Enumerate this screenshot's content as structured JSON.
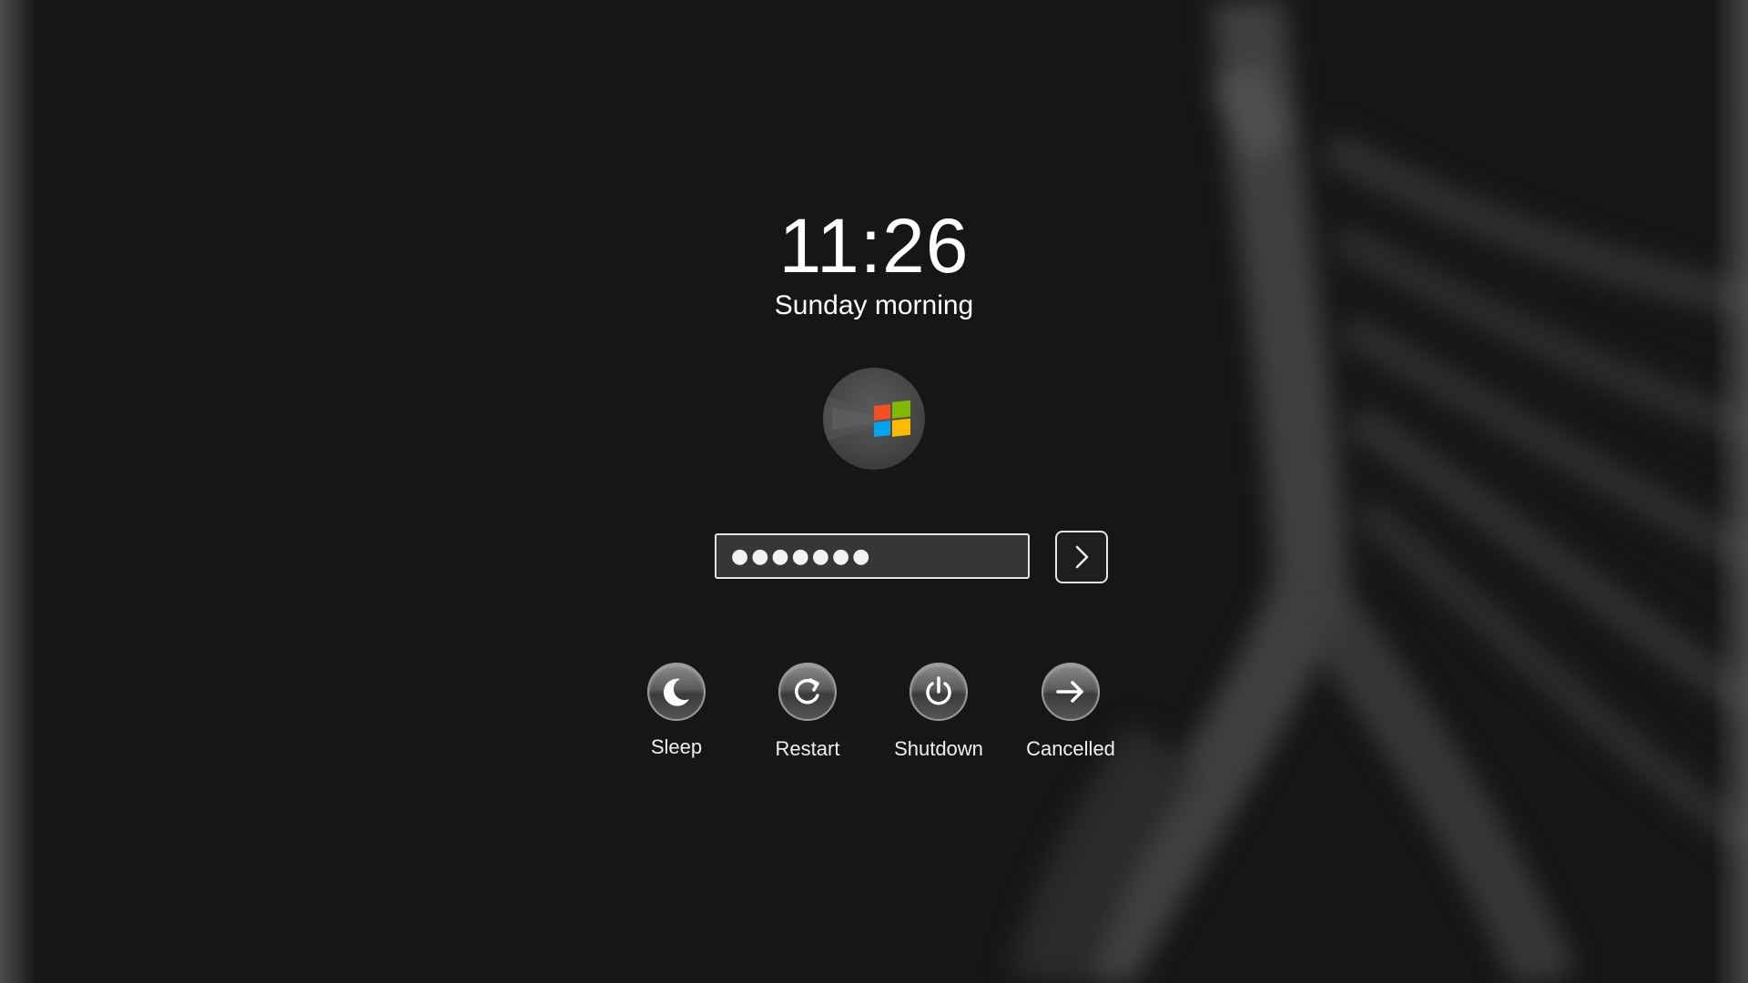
{
  "lock_screen": {
    "time": "11:26",
    "greeting": "Sunday morning"
  },
  "user": {
    "avatar_icon": "windows-logo-icon"
  },
  "login": {
    "password_masked": "●●●●●●●",
    "submit_icon": "chevron-right-icon"
  },
  "power_actions": [
    {
      "label": "Sleep",
      "icon": "moon-icon"
    },
    {
      "label": "Restart",
      "icon": "restart-icon"
    },
    {
      "label": "Shutdown",
      "icon": "power-icon"
    },
    {
      "label": "Cancelled",
      "icon": "arrow-right-icon"
    }
  ],
  "colors": {
    "background": "#161616",
    "text": "#ffffff",
    "field_border": "#e6e6e6",
    "logo_red": "#f25022",
    "logo_green": "#7fba00",
    "logo_blue": "#00a4ef",
    "logo_yellow": "#ffb900"
  }
}
